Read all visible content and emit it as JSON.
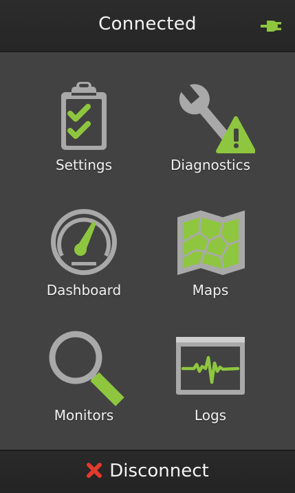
{
  "header": {
    "title": "Connected",
    "connection_icon": "plug-icon"
  },
  "menu": {
    "items": [
      {
        "label": "Settings",
        "icon": "clipboard-checklist-icon"
      },
      {
        "label": "Diagnostics",
        "icon": "wrench-warning-icon"
      },
      {
        "label": "Dashboard",
        "icon": "gauge-icon"
      },
      {
        "label": "Maps",
        "icon": "map-icon"
      },
      {
        "label": "Monitors",
        "icon": "magnifier-icon"
      },
      {
        "label": "Logs",
        "icon": "waveform-monitor-icon"
      }
    ]
  },
  "footer": {
    "disconnect_label": "Disconnect",
    "disconnect_icon": "close-x-icon"
  },
  "colors": {
    "accent": "#8ec63f",
    "icon_gray": "#a9a9a9",
    "alert_red": "#e23b2e",
    "background": "#424242",
    "bar": "#262626"
  }
}
